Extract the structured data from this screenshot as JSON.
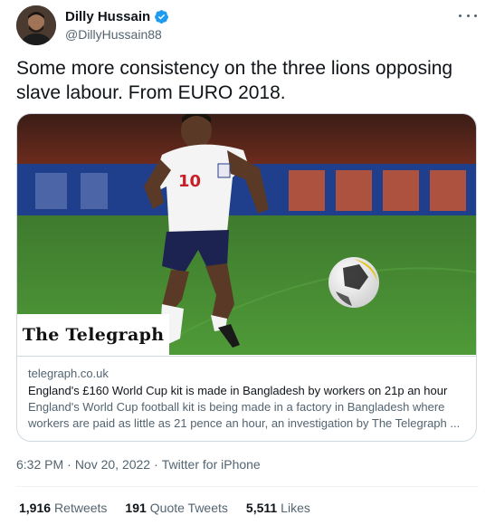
{
  "author": {
    "display_name": "Dilly Hussain",
    "handle": "@DillyHussain88",
    "verified": true
  },
  "tweet": {
    "text": "Some more consistency on the three lions opposing slave labour. From EURO 2018."
  },
  "card": {
    "brand": "The Telegraph",
    "domain": "telegraph.co.uk",
    "title": "England's £160 World Cup kit is made in Bangladesh by workers on 21p an hour",
    "description": "England's World Cup football kit is being made in a factory in Bangladesh where\nworkers are paid as little as 21 pence an hour, an investigation by The Telegraph ..."
  },
  "meta": {
    "time": "6:32 PM",
    "separator": "·",
    "date": "Nov 20, 2022",
    "source": "Twitter for iPhone"
  },
  "stats": {
    "retweets_count": "1,916",
    "retweets_label": "Retweets",
    "quotes_count": "191",
    "quotes_label": "Quote Tweets",
    "likes_count": "5,511",
    "likes_label": "Likes"
  },
  "colors": {
    "accent": "#1d9bf0",
    "secondary_text": "#536471",
    "border": "#cfd9de"
  },
  "icons": {
    "verified": "verified-badge-icon",
    "more": "more-options-icon"
  }
}
